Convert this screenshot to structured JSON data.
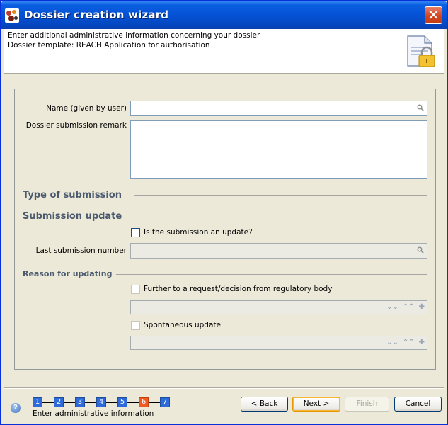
{
  "window": {
    "title": "Dossier creation wizard",
    "close_label": "✕"
  },
  "header": {
    "line1": "Enter additional administrative information concerning your dossier",
    "line2": "Dossier template: REACH Application for authorisation"
  },
  "form": {
    "name_label": "Name (given by user)",
    "name_value": "",
    "remark_label": "Dossier submission remark",
    "remark_value": "",
    "type_of_submission": "Type of submission",
    "submission_update": "Submission update",
    "is_update_label": "Is the submission an update?",
    "last_submission_label": "Last submission number",
    "last_submission_value": "",
    "reason_for_updating": "Reason for updating",
    "further_request_label": "Further to a request/decision from regulatory body",
    "spontaneous_label": "Spontaneous update"
  },
  "wizard": {
    "steps": [
      "1",
      "2",
      "3",
      "4",
      "5",
      "6",
      "7"
    ],
    "active_step": "6",
    "caption": "Enter administrative information"
  },
  "buttons": {
    "back": {
      "prefix": "< ",
      "mnemonic": "B",
      "rest": "ack"
    },
    "next": {
      "mnemonic": "N",
      "rest": "ext >"
    },
    "finish": {
      "mnemonic": "F",
      "rest": "inish"
    },
    "cancel": {
      "mnemonic": "C",
      "rest": "ancel"
    }
  },
  "colors": {
    "title_bar": "#0552d6",
    "active_step": "#f05a23",
    "step": "#2f6ad9",
    "section_text": "#4b5a6e"
  }
}
